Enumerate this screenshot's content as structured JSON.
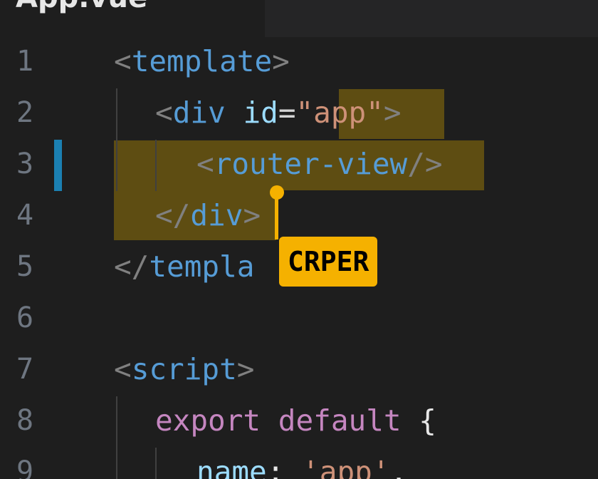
{
  "tab": {
    "title": "App.vue"
  },
  "editor": {
    "lines": [
      {
        "num": "1",
        "tokens": [
          [
            "p",
            "<"
          ],
          [
            "t",
            "template"
          ],
          [
            "p",
            ">"
          ]
        ]
      },
      {
        "num": "2",
        "tokens": [
          [
            "p",
            "<"
          ],
          [
            "t",
            "div"
          ],
          [
            "w",
            " "
          ],
          [
            "a",
            "id"
          ],
          [
            "eq",
            "="
          ],
          [
            "s",
            "\"app\""
          ],
          [
            "p",
            ">"
          ]
        ]
      },
      {
        "num": "3",
        "tokens": [
          [
            "p",
            "<"
          ],
          [
            "t",
            "router-view"
          ],
          [
            "p",
            "/>"
          ]
        ]
      },
      {
        "num": "4",
        "tokens": [
          [
            "p",
            "</"
          ],
          [
            "t",
            "div"
          ],
          [
            "p",
            ">"
          ]
        ]
      },
      {
        "num": "5",
        "tokens": [
          [
            "p",
            "</"
          ],
          [
            "t",
            "templa"
          ]
        ]
      },
      {
        "num": "6",
        "tokens": []
      },
      {
        "num": "7",
        "tokens": [
          [
            "p",
            "<"
          ],
          [
            "t",
            "script"
          ],
          [
            "p",
            ">"
          ]
        ]
      },
      {
        "num": "8",
        "tokens": [
          [
            "k",
            "export"
          ],
          [
            "w",
            " "
          ],
          [
            "k",
            "default"
          ],
          [
            "w",
            " {"
          ]
        ]
      },
      {
        "num": "9",
        "tokens": [
          [
            "a",
            "name"
          ],
          [
            "w",
            ": "
          ],
          [
            "s",
            "'app'"
          ],
          [
            "w",
            ","
          ]
        ]
      }
    ]
  },
  "collaborator": {
    "name": "CRPER",
    "color": "#f5b100"
  },
  "colors": {
    "background": "#1e1e1e",
    "tag": "#569cd6",
    "punctuation": "#808080",
    "attribute": "#9cdcfe",
    "string": "#ce9178",
    "keyword": "#c586c0",
    "selection": "#5e4d12",
    "modified_gutter": "#1b80b2"
  }
}
